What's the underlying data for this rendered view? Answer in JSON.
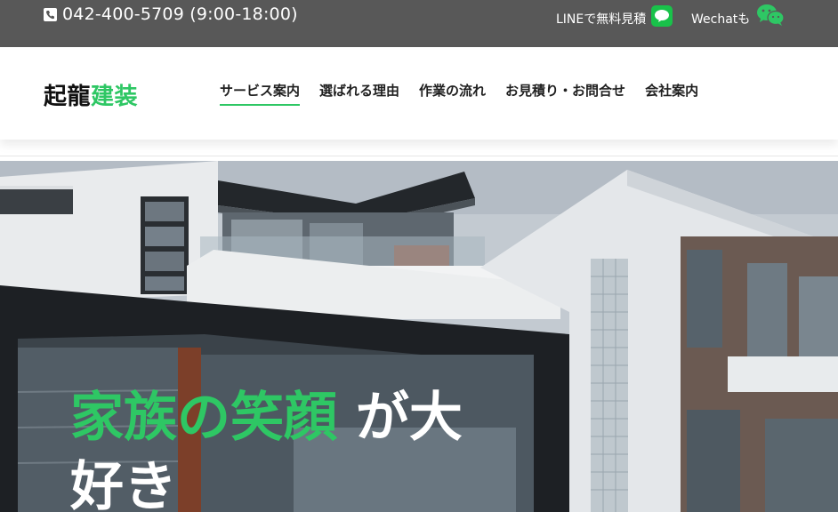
{
  "topbar": {
    "phone": "042-400-5709 (9:00-18:00)",
    "line_label": "LINEで無料見積",
    "line_icon": "line-icon",
    "wechat_label": "Wechatも",
    "wechat_icon": "wechat-icon"
  },
  "logo": {
    "black": "起龍",
    "green": "建装"
  },
  "nav": {
    "items": [
      "サービス案内",
      "選ばれる理由",
      "作業の流れ",
      "お見積り・お問合せ",
      "会社案内"
    ]
  },
  "hero": {
    "title_green": "家族の笑顔",
    "title_white_1": " が大",
    "title_white_2": "好き"
  },
  "colors": {
    "accent": "#2ec764",
    "topbar": "#585858",
    "line_green": "#19c24a"
  }
}
